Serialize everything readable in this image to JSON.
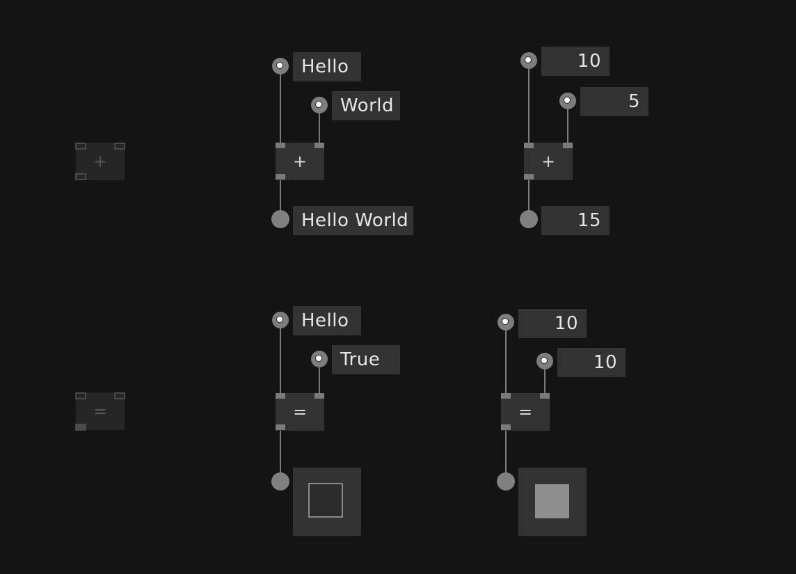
{
  "palette": {
    "canvas": "#141414",
    "node": "#333333",
    "wire": "#7a7a7a",
    "text": "#e6e6e6",
    "ghost": "#262626"
  },
  "palette_nodes": {
    "add_symbol": "+",
    "equals_symbol": "="
  },
  "graph_add_text": {
    "input_a": "Hello",
    "input_b": "World",
    "operator": "+",
    "output": "Hello World"
  },
  "graph_add_number": {
    "input_a": "10",
    "input_b": "5",
    "operator": "+",
    "output": "15"
  },
  "graph_equals_text": {
    "input_a": "Hello",
    "input_b": "True",
    "operator": "=",
    "output_checked": false
  },
  "graph_equals_number": {
    "input_a": "10",
    "input_b": "10",
    "operator": "=",
    "output_checked": true
  }
}
